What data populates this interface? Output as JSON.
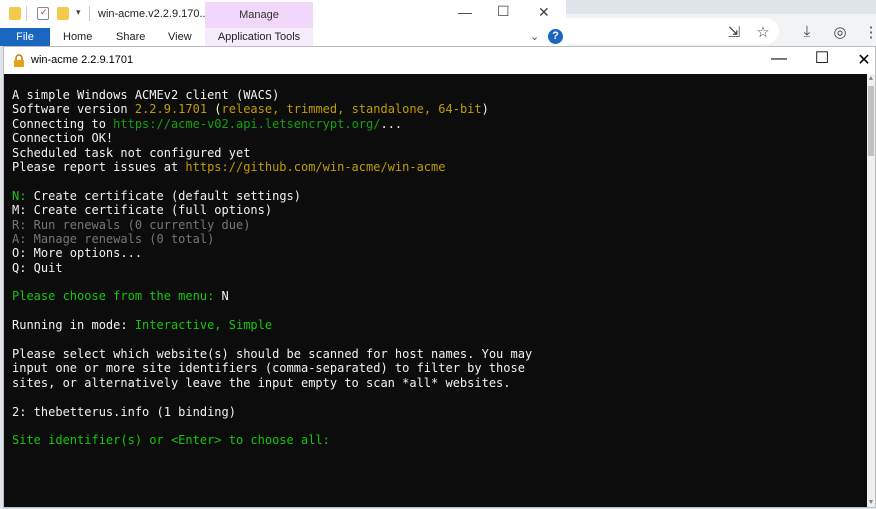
{
  "explorer": {
    "title": "win-acme.v2.2.9.170...",
    "manage_tab": "Manage",
    "ribbon_tabs": [
      "File",
      "Home",
      "Share",
      "View",
      "Application Tools"
    ],
    "help": "?"
  },
  "console": {
    "title": "win-acme 2.2.9.1701",
    "lines": [
      [
        {
          "t": "A simple Windows ACMEv2 client (WACS)",
          "c": "w"
        }
      ],
      [
        {
          "t": "Software version ",
          "c": "w"
        },
        {
          "t": "2.2.9.1701",
          "c": "y"
        },
        {
          "t": " (",
          "c": "w"
        },
        {
          "t": "release, trimmed, standalone, 64-bit",
          "c": "y"
        },
        {
          "t": ")",
          "c": "w"
        }
      ],
      [
        {
          "t": "Connecting to ",
          "c": "w"
        },
        {
          "t": "https://acme-v02.api.letsencrypt.org/",
          "c": "g"
        },
        {
          "t": "...",
          "c": "w"
        }
      ],
      [
        {
          "t": "Connection OK!",
          "c": "w"
        }
      ],
      [
        {
          "t": "Scheduled task not configured yet",
          "c": "w"
        }
      ],
      [
        {
          "t": "Please report issues at ",
          "c": "w"
        },
        {
          "t": "https://github.com/win-acme/win-acme",
          "c": "y"
        }
      ],
      [],
      [
        {
          "t": "N:",
          "c": "gl"
        },
        {
          "t": " Create certificate (default settings)",
          "c": "w"
        }
      ],
      [
        {
          "t": "M: Create certificate (full options)",
          "c": "w"
        }
      ],
      [
        {
          "t": "R: Run renewals (0 currently due)",
          "c": "d"
        }
      ],
      [
        {
          "t": "A: Manage renewals (0 total)",
          "c": "d"
        }
      ],
      [
        {
          "t": "O: More options...",
          "c": "w"
        }
      ],
      [
        {
          "t": "Q: Quit",
          "c": "w"
        }
      ],
      [],
      [
        {
          "t": "Please choose from the menu: ",
          "c": "gl"
        },
        {
          "t": "N",
          "c": "w"
        }
      ],
      [],
      [
        {
          "t": "Running in mode: ",
          "c": "w"
        },
        {
          "t": "Interactive, Simple",
          "c": "gl"
        }
      ],
      [],
      [
        {
          "t": "Please select which website(s) should be scanned for host names. You may",
          "c": "w"
        }
      ],
      [
        {
          "t": "input one or more site identifiers (comma-separated) to filter by those",
          "c": "w"
        }
      ],
      [
        {
          "t": "sites, or alternatively leave the input empty to scan *all* websites.",
          "c": "w"
        }
      ],
      [],
      [
        {
          "t": "2: thebetterus.info (1 binding)",
          "c": "w"
        }
      ],
      [],
      [
        {
          "t": "Site identifier(s) or <Enter> to choose all: ",
          "c": "gl"
        }
      ]
    ]
  },
  "colors": {
    "terminal_bg": "#0c0c0c",
    "yellow": "#c19c00",
    "green": "#13a10e",
    "bright_green": "#16c60c",
    "gray": "#767676",
    "file_tab": "#1a67c0",
    "manage_tab": "#f1d7f9"
  },
  "icons": [
    "folder-icon",
    "properties-icon",
    "folder-icon",
    "dropdown-icon",
    "minimize-icon",
    "maximize-icon",
    "close-icon",
    "help-icon",
    "lock-icon",
    "install-app-icon",
    "star-icon",
    "download-icon",
    "profile-icon",
    "menu-icon"
  ]
}
